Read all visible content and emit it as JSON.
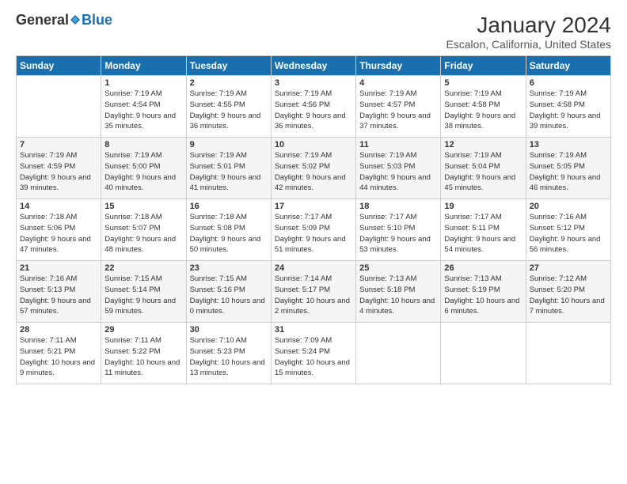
{
  "header": {
    "logo_general": "General",
    "logo_blue": "Blue",
    "month_title": "January 2024",
    "location": "Escalon, California, United States"
  },
  "days_of_week": [
    "Sunday",
    "Monday",
    "Tuesday",
    "Wednesday",
    "Thursday",
    "Friday",
    "Saturday"
  ],
  "weeks": [
    [
      {
        "day": "",
        "sunrise": "",
        "sunset": "",
        "daylight": ""
      },
      {
        "day": "1",
        "sunrise": "Sunrise: 7:19 AM",
        "sunset": "Sunset: 4:54 PM",
        "daylight": "Daylight: 9 hours and 35 minutes."
      },
      {
        "day": "2",
        "sunrise": "Sunrise: 7:19 AM",
        "sunset": "Sunset: 4:55 PM",
        "daylight": "Daylight: 9 hours and 36 minutes."
      },
      {
        "day": "3",
        "sunrise": "Sunrise: 7:19 AM",
        "sunset": "Sunset: 4:56 PM",
        "daylight": "Daylight: 9 hours and 36 minutes."
      },
      {
        "day": "4",
        "sunrise": "Sunrise: 7:19 AM",
        "sunset": "Sunset: 4:57 PM",
        "daylight": "Daylight: 9 hours and 37 minutes."
      },
      {
        "day": "5",
        "sunrise": "Sunrise: 7:19 AM",
        "sunset": "Sunset: 4:58 PM",
        "daylight": "Daylight: 9 hours and 38 minutes."
      },
      {
        "day": "6",
        "sunrise": "Sunrise: 7:19 AM",
        "sunset": "Sunset: 4:58 PM",
        "daylight": "Daylight: 9 hours and 39 minutes."
      }
    ],
    [
      {
        "day": "7",
        "sunrise": "Sunrise: 7:19 AM",
        "sunset": "Sunset: 4:59 PM",
        "daylight": "Daylight: 9 hours and 39 minutes."
      },
      {
        "day": "8",
        "sunrise": "Sunrise: 7:19 AM",
        "sunset": "Sunset: 5:00 PM",
        "daylight": "Daylight: 9 hours and 40 minutes."
      },
      {
        "day": "9",
        "sunrise": "Sunrise: 7:19 AM",
        "sunset": "Sunset: 5:01 PM",
        "daylight": "Daylight: 9 hours and 41 minutes."
      },
      {
        "day": "10",
        "sunrise": "Sunrise: 7:19 AM",
        "sunset": "Sunset: 5:02 PM",
        "daylight": "Daylight: 9 hours and 42 minutes."
      },
      {
        "day": "11",
        "sunrise": "Sunrise: 7:19 AM",
        "sunset": "Sunset: 5:03 PM",
        "daylight": "Daylight: 9 hours and 44 minutes."
      },
      {
        "day": "12",
        "sunrise": "Sunrise: 7:19 AM",
        "sunset": "Sunset: 5:04 PM",
        "daylight": "Daylight: 9 hours and 45 minutes."
      },
      {
        "day": "13",
        "sunrise": "Sunrise: 7:19 AM",
        "sunset": "Sunset: 5:05 PM",
        "daylight": "Daylight: 9 hours and 46 minutes."
      }
    ],
    [
      {
        "day": "14",
        "sunrise": "Sunrise: 7:18 AM",
        "sunset": "Sunset: 5:06 PM",
        "daylight": "Daylight: 9 hours and 47 minutes."
      },
      {
        "day": "15",
        "sunrise": "Sunrise: 7:18 AM",
        "sunset": "Sunset: 5:07 PM",
        "daylight": "Daylight: 9 hours and 48 minutes."
      },
      {
        "day": "16",
        "sunrise": "Sunrise: 7:18 AM",
        "sunset": "Sunset: 5:08 PM",
        "daylight": "Daylight: 9 hours and 50 minutes."
      },
      {
        "day": "17",
        "sunrise": "Sunrise: 7:17 AM",
        "sunset": "Sunset: 5:09 PM",
        "daylight": "Daylight: 9 hours and 51 minutes."
      },
      {
        "day": "18",
        "sunrise": "Sunrise: 7:17 AM",
        "sunset": "Sunset: 5:10 PM",
        "daylight": "Daylight: 9 hours and 53 minutes."
      },
      {
        "day": "19",
        "sunrise": "Sunrise: 7:17 AM",
        "sunset": "Sunset: 5:11 PM",
        "daylight": "Daylight: 9 hours and 54 minutes."
      },
      {
        "day": "20",
        "sunrise": "Sunrise: 7:16 AM",
        "sunset": "Sunset: 5:12 PM",
        "daylight": "Daylight: 9 hours and 56 minutes."
      }
    ],
    [
      {
        "day": "21",
        "sunrise": "Sunrise: 7:16 AM",
        "sunset": "Sunset: 5:13 PM",
        "daylight": "Daylight: 9 hours and 57 minutes."
      },
      {
        "day": "22",
        "sunrise": "Sunrise: 7:15 AM",
        "sunset": "Sunset: 5:14 PM",
        "daylight": "Daylight: 9 hours and 59 minutes."
      },
      {
        "day": "23",
        "sunrise": "Sunrise: 7:15 AM",
        "sunset": "Sunset: 5:16 PM",
        "daylight": "Daylight: 10 hours and 0 minutes."
      },
      {
        "day": "24",
        "sunrise": "Sunrise: 7:14 AM",
        "sunset": "Sunset: 5:17 PM",
        "daylight": "Daylight: 10 hours and 2 minutes."
      },
      {
        "day": "25",
        "sunrise": "Sunrise: 7:13 AM",
        "sunset": "Sunset: 5:18 PM",
        "daylight": "Daylight: 10 hours and 4 minutes."
      },
      {
        "day": "26",
        "sunrise": "Sunrise: 7:13 AM",
        "sunset": "Sunset: 5:19 PM",
        "daylight": "Daylight: 10 hours and 6 minutes."
      },
      {
        "day": "27",
        "sunrise": "Sunrise: 7:12 AM",
        "sunset": "Sunset: 5:20 PM",
        "daylight": "Daylight: 10 hours and 7 minutes."
      }
    ],
    [
      {
        "day": "28",
        "sunrise": "Sunrise: 7:11 AM",
        "sunset": "Sunset: 5:21 PM",
        "daylight": "Daylight: 10 hours and 9 minutes."
      },
      {
        "day": "29",
        "sunrise": "Sunrise: 7:11 AM",
        "sunset": "Sunset: 5:22 PM",
        "daylight": "Daylight: 10 hours and 11 minutes."
      },
      {
        "day": "30",
        "sunrise": "Sunrise: 7:10 AM",
        "sunset": "Sunset: 5:23 PM",
        "daylight": "Daylight: 10 hours and 13 minutes."
      },
      {
        "day": "31",
        "sunrise": "Sunrise: 7:09 AM",
        "sunset": "Sunset: 5:24 PM",
        "daylight": "Daylight: 10 hours and 15 minutes."
      },
      {
        "day": "",
        "sunrise": "",
        "sunset": "",
        "daylight": ""
      },
      {
        "day": "",
        "sunrise": "",
        "sunset": "",
        "daylight": ""
      },
      {
        "day": "",
        "sunrise": "",
        "sunset": "",
        "daylight": ""
      }
    ]
  ]
}
